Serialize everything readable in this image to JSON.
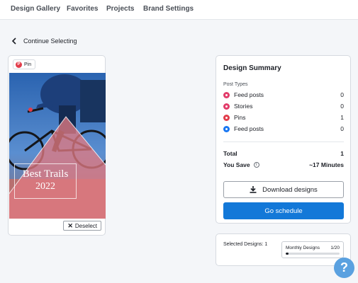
{
  "nav": {
    "items": [
      "Design Gallery",
      "Favorites",
      "Projects",
      "Brand Settings"
    ]
  },
  "back": {
    "label": "Continue Selecting"
  },
  "design_card": {
    "badge_label": "Pin",
    "title_line1": "Best Trails",
    "title_line2": "2022",
    "deselect_label": "Deselect"
  },
  "summary": {
    "title": "Design Summary",
    "post_types_label": "Post Types",
    "rows": [
      {
        "label": "Feed posts",
        "value": "0",
        "icon": "instagram-icon",
        "color": "#e23c6a"
      },
      {
        "label": "Stories",
        "value": "0",
        "icon": "instagram-icon",
        "color": "#e23c6a"
      },
      {
        "label": "Pins",
        "value": "1",
        "icon": "pinterest-icon",
        "color": "#e23c4a"
      },
      {
        "label": "Feed posts",
        "value": "0",
        "icon": "facebook-icon",
        "color": "#1877f2"
      }
    ],
    "total_label": "Total",
    "total_value": "1",
    "you_save_label": "You Save",
    "you_save_value": "~17 Minutes",
    "download_label": "Download designs",
    "schedule_label": "Go schedule"
  },
  "selected": {
    "label": "Selected Designs: 1",
    "monthly_label": "Monthly Designs",
    "monthly_count": "1/20",
    "monthly_progress": 0.05
  },
  "help": {
    "label": "?"
  },
  "colors": {
    "accent": "#1378d8",
    "help": "#5aa1e0"
  }
}
